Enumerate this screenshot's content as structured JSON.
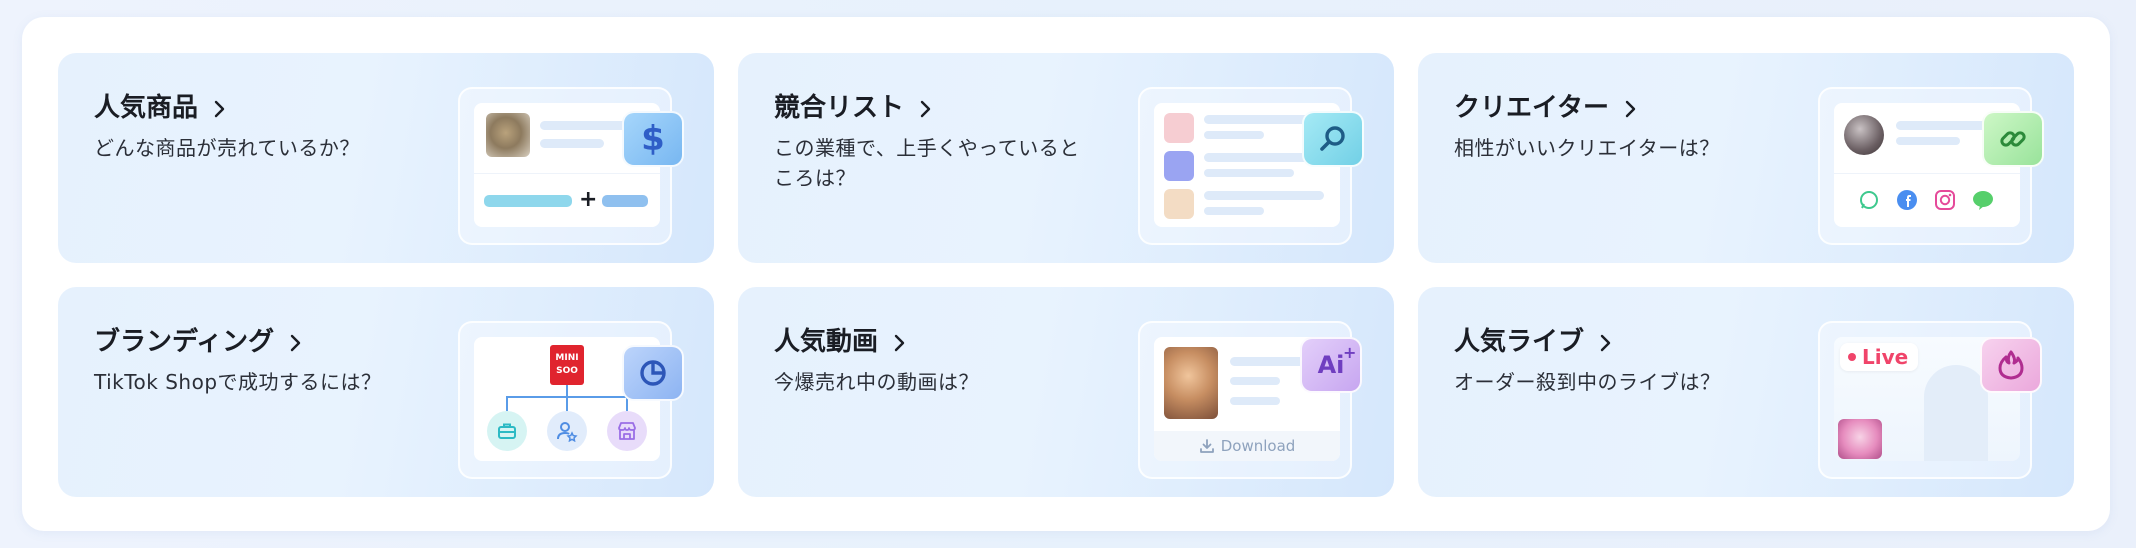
{
  "cards": [
    {
      "title": "人気商品",
      "desc": "どんな商品が売れているか？",
      "plus": "+",
      "badge_icon": "dollar-icon",
      "badge_text": "$"
    },
    {
      "title": "競合リスト",
      "desc": "この業種で、上手くやっていると ころは？",
      "badge_icon": "search-icon"
    },
    {
      "title": "クリエイター",
      "desc": "相性がいいクリエイターは？",
      "badge_icon": "link-icon"
    },
    {
      "title": "ブランディング",
      "desc": "TikTok Shopで成功するには？",
      "brand_logo_top": "MINI",
      "brand_logo_bottom": "SOO",
      "badge_icon": "pie-chart-icon"
    },
    {
      "title": "人気動画",
      "desc": "今爆売れ中の動画は？",
      "download_label": "Download",
      "badge_icon": "ai-icon",
      "badge_text": "Ai"
    },
    {
      "title": "人気ライブ",
      "desc": "オーダー殺到中のライブは？",
      "live_label": "Live",
      "badge_icon": "fire-icon"
    }
  ],
  "colors": {
    "dollar_badge": "#8fc9f6",
    "search_badge": "#8ee0f0",
    "link_badge": "#b9efb6",
    "pie_badge": "#a9c8f7",
    "ai_badge": "#d8c0f6",
    "fire_badge": "#f3bfe6",
    "live_red": "#f0446a"
  }
}
